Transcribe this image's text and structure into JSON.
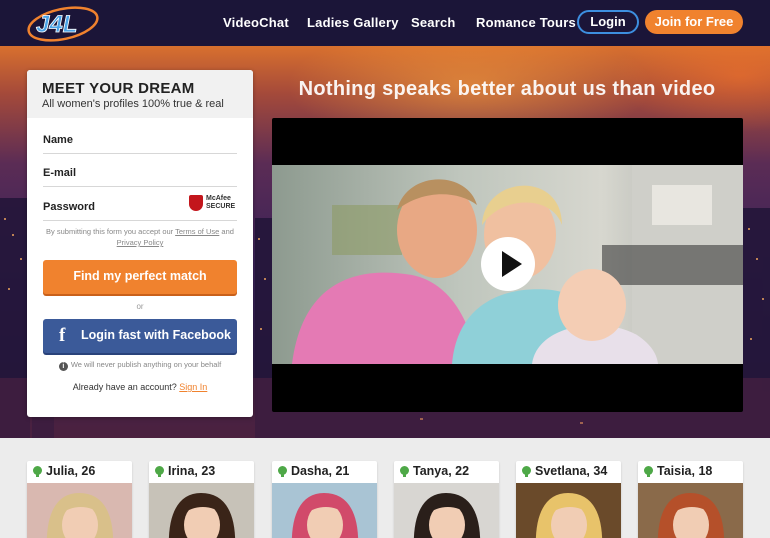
{
  "header": {
    "logo_text": "J4L",
    "nav": [
      "VideoChat",
      "Ladies Gallery",
      "Search",
      "Romance Tours"
    ],
    "login_label": "Login",
    "join_label": "Join for Free"
  },
  "hero": {
    "title": "Nothing speaks better about us than video"
  },
  "form": {
    "title": "MEET YOUR DREAM",
    "subtitle": "All women's profiles 100% true & real",
    "name_label": "Name",
    "email_label": "E-mail",
    "password_label": "Password",
    "mcafee_line1": "McAfee",
    "mcafee_line2": "SECURE",
    "terms_prefix": "By submitting this form you accept our",
    "terms_link": "Terms of Use",
    "terms_and": "and",
    "privacy_link": "Privacy Policy",
    "find_button": "Find my perfect match",
    "or_text": "or",
    "facebook_button": "Login fast with Facebook",
    "notice": "We will never publish anything on your behalf",
    "already_text": "Already have an account?",
    "sign_in_link": "Sign In"
  },
  "profiles": [
    {
      "name": "Julia, 26",
      "hair": "#d9c08a",
      "bg": "#d9b8b0"
    },
    {
      "name": "Irina, 23",
      "hair": "#3a2418",
      "bg": "#c7c2b8"
    },
    {
      "name": "Dasha, 21",
      "hair": "#d14a6a",
      "bg": "#a9c4d4"
    },
    {
      "name": "Tanya, 22",
      "hair": "#2a1f1a",
      "bg": "#d8d6d2"
    },
    {
      "name": "Svetlana, 34",
      "hair": "#e8c36a",
      "bg": "#6a4a2a"
    },
    {
      "name": "Taisia, 18",
      "hair": "#b5502a",
      "bg": "#8a6a4a"
    }
  ]
}
